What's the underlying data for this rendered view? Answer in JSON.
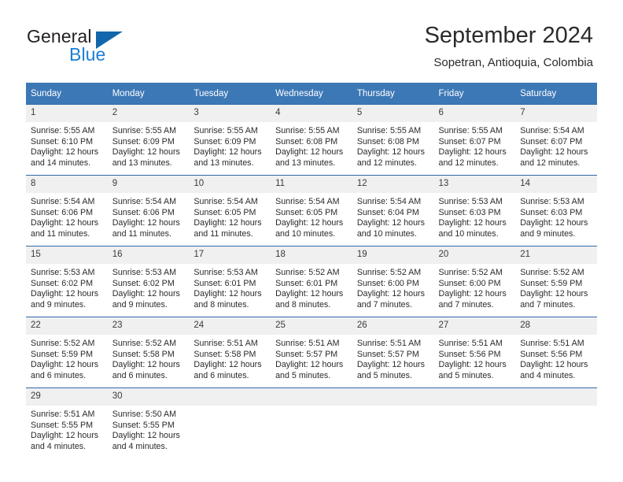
{
  "brand": {
    "line1": "General",
    "line2": "Blue",
    "flag_color": "#1266ab",
    "blue_color": "#1b7fd4"
  },
  "header": {
    "title": "September 2024",
    "location": "Sopetran, Antioquia, Colombia"
  },
  "theme": {
    "header_bg": "#3d78b6",
    "daynum_bg": "#f0f0f0",
    "row_border": "#2f6ca8"
  },
  "weekdays": [
    "Sunday",
    "Monday",
    "Tuesday",
    "Wednesday",
    "Thursday",
    "Friday",
    "Saturday"
  ],
  "labels": {
    "sunrise_prefix": "Sunrise:",
    "sunset_prefix": "Sunset:",
    "daylight_prefix": "Daylight:"
  },
  "weeks": [
    [
      {
        "day": "1",
        "sunrise": "Sunrise: 5:55 AM",
        "sunset": "Sunset: 6:10 PM",
        "daylight1": "Daylight: 12 hours",
        "daylight2": "and 14 minutes."
      },
      {
        "day": "2",
        "sunrise": "Sunrise: 5:55 AM",
        "sunset": "Sunset: 6:09 PM",
        "daylight1": "Daylight: 12 hours",
        "daylight2": "and 13 minutes."
      },
      {
        "day": "3",
        "sunrise": "Sunrise: 5:55 AM",
        "sunset": "Sunset: 6:09 PM",
        "daylight1": "Daylight: 12 hours",
        "daylight2": "and 13 minutes."
      },
      {
        "day": "4",
        "sunrise": "Sunrise: 5:55 AM",
        "sunset": "Sunset: 6:08 PM",
        "daylight1": "Daylight: 12 hours",
        "daylight2": "and 13 minutes."
      },
      {
        "day": "5",
        "sunrise": "Sunrise: 5:55 AM",
        "sunset": "Sunset: 6:08 PM",
        "daylight1": "Daylight: 12 hours",
        "daylight2": "and 12 minutes."
      },
      {
        "day": "6",
        "sunrise": "Sunrise: 5:55 AM",
        "sunset": "Sunset: 6:07 PM",
        "daylight1": "Daylight: 12 hours",
        "daylight2": "and 12 minutes."
      },
      {
        "day": "7",
        "sunrise": "Sunrise: 5:54 AM",
        "sunset": "Sunset: 6:07 PM",
        "daylight1": "Daylight: 12 hours",
        "daylight2": "and 12 minutes."
      }
    ],
    [
      {
        "day": "8",
        "sunrise": "Sunrise: 5:54 AM",
        "sunset": "Sunset: 6:06 PM",
        "daylight1": "Daylight: 12 hours",
        "daylight2": "and 11 minutes."
      },
      {
        "day": "9",
        "sunrise": "Sunrise: 5:54 AM",
        "sunset": "Sunset: 6:06 PM",
        "daylight1": "Daylight: 12 hours",
        "daylight2": "and 11 minutes."
      },
      {
        "day": "10",
        "sunrise": "Sunrise: 5:54 AM",
        "sunset": "Sunset: 6:05 PM",
        "daylight1": "Daylight: 12 hours",
        "daylight2": "and 11 minutes."
      },
      {
        "day": "11",
        "sunrise": "Sunrise: 5:54 AM",
        "sunset": "Sunset: 6:05 PM",
        "daylight1": "Daylight: 12 hours",
        "daylight2": "and 10 minutes."
      },
      {
        "day": "12",
        "sunrise": "Sunrise: 5:54 AM",
        "sunset": "Sunset: 6:04 PM",
        "daylight1": "Daylight: 12 hours",
        "daylight2": "and 10 minutes."
      },
      {
        "day": "13",
        "sunrise": "Sunrise: 5:53 AM",
        "sunset": "Sunset: 6:03 PM",
        "daylight1": "Daylight: 12 hours",
        "daylight2": "and 10 minutes."
      },
      {
        "day": "14",
        "sunrise": "Sunrise: 5:53 AM",
        "sunset": "Sunset: 6:03 PM",
        "daylight1": "Daylight: 12 hours",
        "daylight2": "and 9 minutes."
      }
    ],
    [
      {
        "day": "15",
        "sunrise": "Sunrise: 5:53 AM",
        "sunset": "Sunset: 6:02 PM",
        "daylight1": "Daylight: 12 hours",
        "daylight2": "and 9 minutes."
      },
      {
        "day": "16",
        "sunrise": "Sunrise: 5:53 AM",
        "sunset": "Sunset: 6:02 PM",
        "daylight1": "Daylight: 12 hours",
        "daylight2": "and 9 minutes."
      },
      {
        "day": "17",
        "sunrise": "Sunrise: 5:53 AM",
        "sunset": "Sunset: 6:01 PM",
        "daylight1": "Daylight: 12 hours",
        "daylight2": "and 8 minutes."
      },
      {
        "day": "18",
        "sunrise": "Sunrise: 5:52 AM",
        "sunset": "Sunset: 6:01 PM",
        "daylight1": "Daylight: 12 hours",
        "daylight2": "and 8 minutes."
      },
      {
        "day": "19",
        "sunrise": "Sunrise: 5:52 AM",
        "sunset": "Sunset: 6:00 PM",
        "daylight1": "Daylight: 12 hours",
        "daylight2": "and 7 minutes."
      },
      {
        "day": "20",
        "sunrise": "Sunrise: 5:52 AM",
        "sunset": "Sunset: 6:00 PM",
        "daylight1": "Daylight: 12 hours",
        "daylight2": "and 7 minutes."
      },
      {
        "day": "21",
        "sunrise": "Sunrise: 5:52 AM",
        "sunset": "Sunset: 5:59 PM",
        "daylight1": "Daylight: 12 hours",
        "daylight2": "and 7 minutes."
      }
    ],
    [
      {
        "day": "22",
        "sunrise": "Sunrise: 5:52 AM",
        "sunset": "Sunset: 5:59 PM",
        "daylight1": "Daylight: 12 hours",
        "daylight2": "and 6 minutes."
      },
      {
        "day": "23",
        "sunrise": "Sunrise: 5:52 AM",
        "sunset": "Sunset: 5:58 PM",
        "daylight1": "Daylight: 12 hours",
        "daylight2": "and 6 minutes."
      },
      {
        "day": "24",
        "sunrise": "Sunrise: 5:51 AM",
        "sunset": "Sunset: 5:58 PM",
        "daylight1": "Daylight: 12 hours",
        "daylight2": "and 6 minutes."
      },
      {
        "day": "25",
        "sunrise": "Sunrise: 5:51 AM",
        "sunset": "Sunset: 5:57 PM",
        "daylight1": "Daylight: 12 hours",
        "daylight2": "and 5 minutes."
      },
      {
        "day": "26",
        "sunrise": "Sunrise: 5:51 AM",
        "sunset": "Sunset: 5:57 PM",
        "daylight1": "Daylight: 12 hours",
        "daylight2": "and 5 minutes."
      },
      {
        "day": "27",
        "sunrise": "Sunrise: 5:51 AM",
        "sunset": "Sunset: 5:56 PM",
        "daylight1": "Daylight: 12 hours",
        "daylight2": "and 5 minutes."
      },
      {
        "day": "28",
        "sunrise": "Sunrise: 5:51 AM",
        "sunset": "Sunset: 5:56 PM",
        "daylight1": "Daylight: 12 hours",
        "daylight2": "and 4 minutes."
      }
    ],
    [
      {
        "day": "29",
        "sunrise": "Sunrise: 5:51 AM",
        "sunset": "Sunset: 5:55 PM",
        "daylight1": "Daylight: 12 hours",
        "daylight2": "and 4 minutes."
      },
      {
        "day": "30",
        "sunrise": "Sunrise: 5:50 AM",
        "sunset": "Sunset: 5:55 PM",
        "daylight1": "Daylight: 12 hours",
        "daylight2": "and 4 minutes."
      },
      {
        "day": "",
        "sunrise": "",
        "sunset": "",
        "daylight1": "",
        "daylight2": ""
      },
      {
        "day": "",
        "sunrise": "",
        "sunset": "",
        "daylight1": "",
        "daylight2": ""
      },
      {
        "day": "",
        "sunrise": "",
        "sunset": "",
        "daylight1": "",
        "daylight2": ""
      },
      {
        "day": "",
        "sunrise": "",
        "sunset": "",
        "daylight1": "",
        "daylight2": ""
      },
      {
        "day": "",
        "sunrise": "",
        "sunset": "",
        "daylight1": "",
        "daylight2": ""
      }
    ]
  ]
}
